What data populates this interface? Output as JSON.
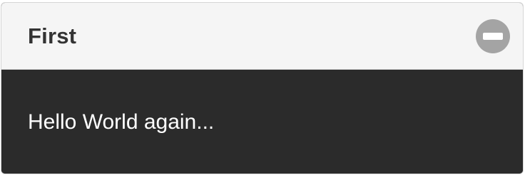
{
  "panel": {
    "title": "First",
    "toggle_icon": "minus-circle-icon",
    "content": "Hello World again..."
  },
  "colors": {
    "header_bg": "#f5f5f5",
    "body_bg": "#2b2b2b",
    "toggle_bg": "#a4a4a4",
    "title_text": "#333333",
    "content_text": "#ffffff"
  }
}
